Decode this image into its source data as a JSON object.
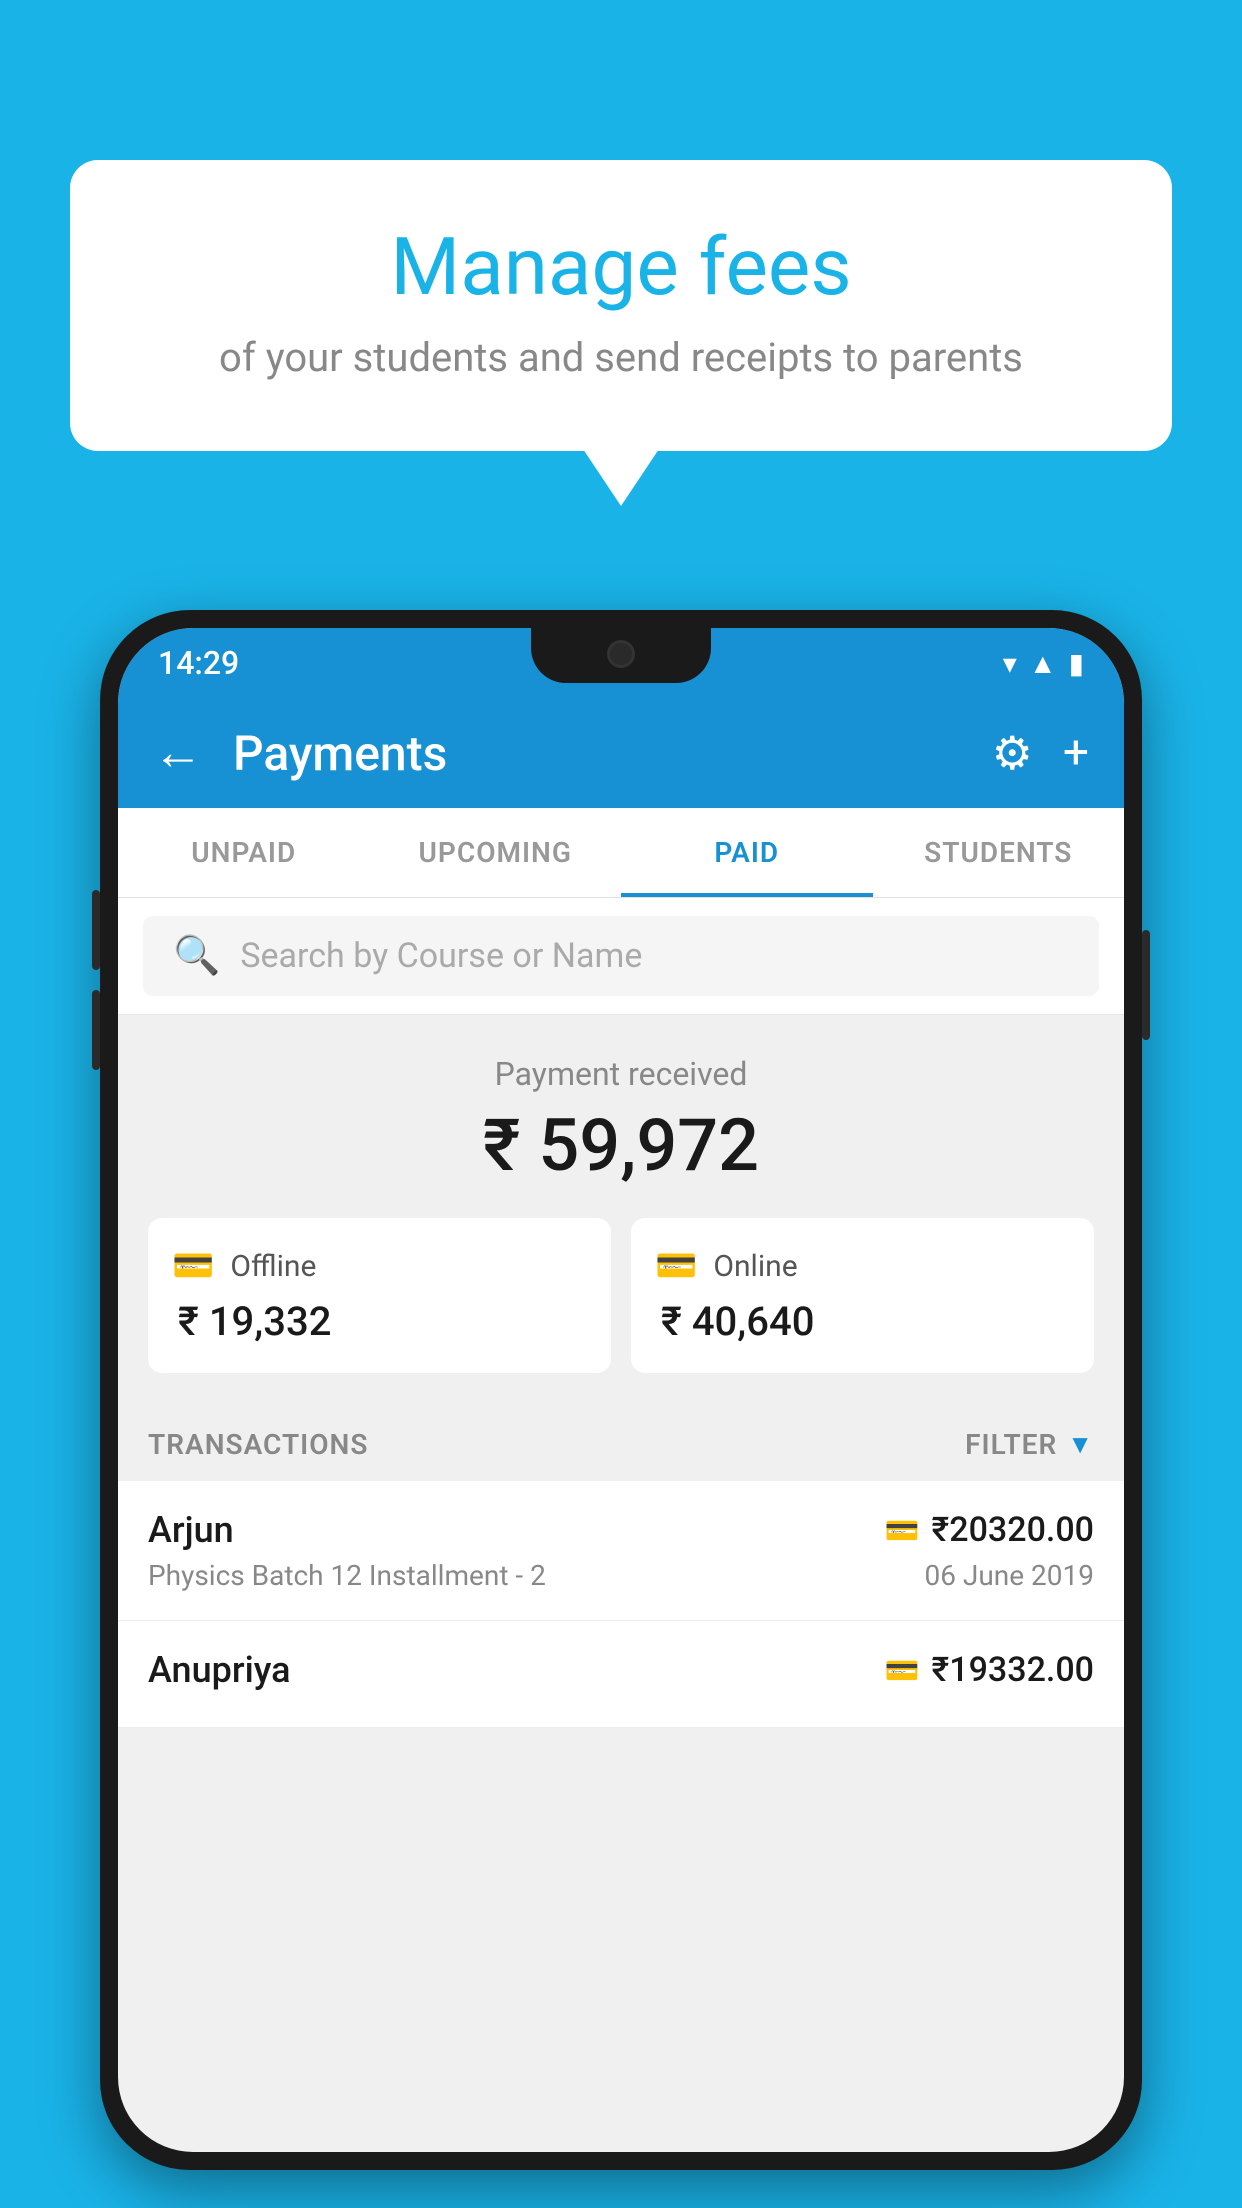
{
  "background_color": "#1ab3e8",
  "bubble": {
    "title": "Manage fees",
    "subtitle": "of your students and send receipts to parents"
  },
  "status_bar": {
    "time": "14:29",
    "wifi": "▾",
    "signal": "▲",
    "battery": "▮"
  },
  "app_bar": {
    "title": "Payments",
    "back_label": "←",
    "gear_label": "⚙",
    "plus_label": "+"
  },
  "tabs": [
    {
      "label": "UNPAID",
      "active": false
    },
    {
      "label": "UPCOMING",
      "active": false
    },
    {
      "label": "PAID",
      "active": true
    },
    {
      "label": "STUDENTS",
      "active": false
    }
  ],
  "search": {
    "placeholder": "Search by Course or Name"
  },
  "payment_received": {
    "label": "Payment received",
    "total": "₹ 59,972",
    "offline_label": "Offline",
    "offline_amount": "₹ 19,332",
    "online_label": "Online",
    "online_amount": "₹ 40,640"
  },
  "transactions_header": {
    "label": "TRANSACTIONS",
    "filter_label": "FILTER"
  },
  "transactions": [
    {
      "name": "Arjun",
      "course": "Physics Batch 12 Installment - 2",
      "amount": "₹20320.00",
      "date": "06 June 2019",
      "payment_type": "online"
    },
    {
      "name": "Anupriya",
      "course": "",
      "amount": "₹19332.00",
      "date": "",
      "payment_type": "offline"
    }
  ]
}
